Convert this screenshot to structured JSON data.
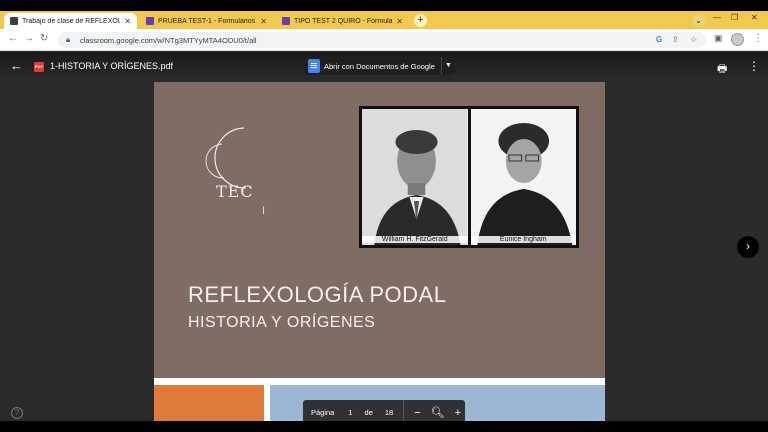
{
  "browser": {
    "tabs": [
      {
        "title": "Trabajo de clase de REFLEXOLOG",
        "active": true,
        "icon": "classroom-icon",
        "color": "#3c4043"
      },
      {
        "title": "PRUEBA TEST-1 - Formularios de",
        "active": false,
        "icon": "forms-icon",
        "color": "#673ab7"
      },
      {
        "title": "TIPO TEST 2 QUIRO - Formulario",
        "active": false,
        "icon": "forms-icon",
        "color": "#673ab7"
      }
    ],
    "new_tab": "+",
    "url": "classroom.google.com/w/NTg3MTYyMTA4ODU0/t/all"
  },
  "viewer": {
    "filename": "1-HISTORIA Y ORÍGENES.pdf",
    "open_with": "Abrir con Documentos de Google",
    "page_label": "Página",
    "current_page": "1",
    "of_label": "de",
    "total_pages": "18",
    "zoom_out": "−",
    "zoom_in": "+"
  },
  "slide": {
    "logo_text": "TEC",
    "title": "REFLEXOLOGÍA PODAL",
    "subtitle": "HISTORIA Y ORÍGENES",
    "photo_left_caption": "William H. FitzGerald",
    "photo_right_caption": "Eunice Ingham",
    "colors": {
      "background": "#7f6c62",
      "orange": "#e07a3b",
      "blue": "#9cb7d3"
    }
  }
}
